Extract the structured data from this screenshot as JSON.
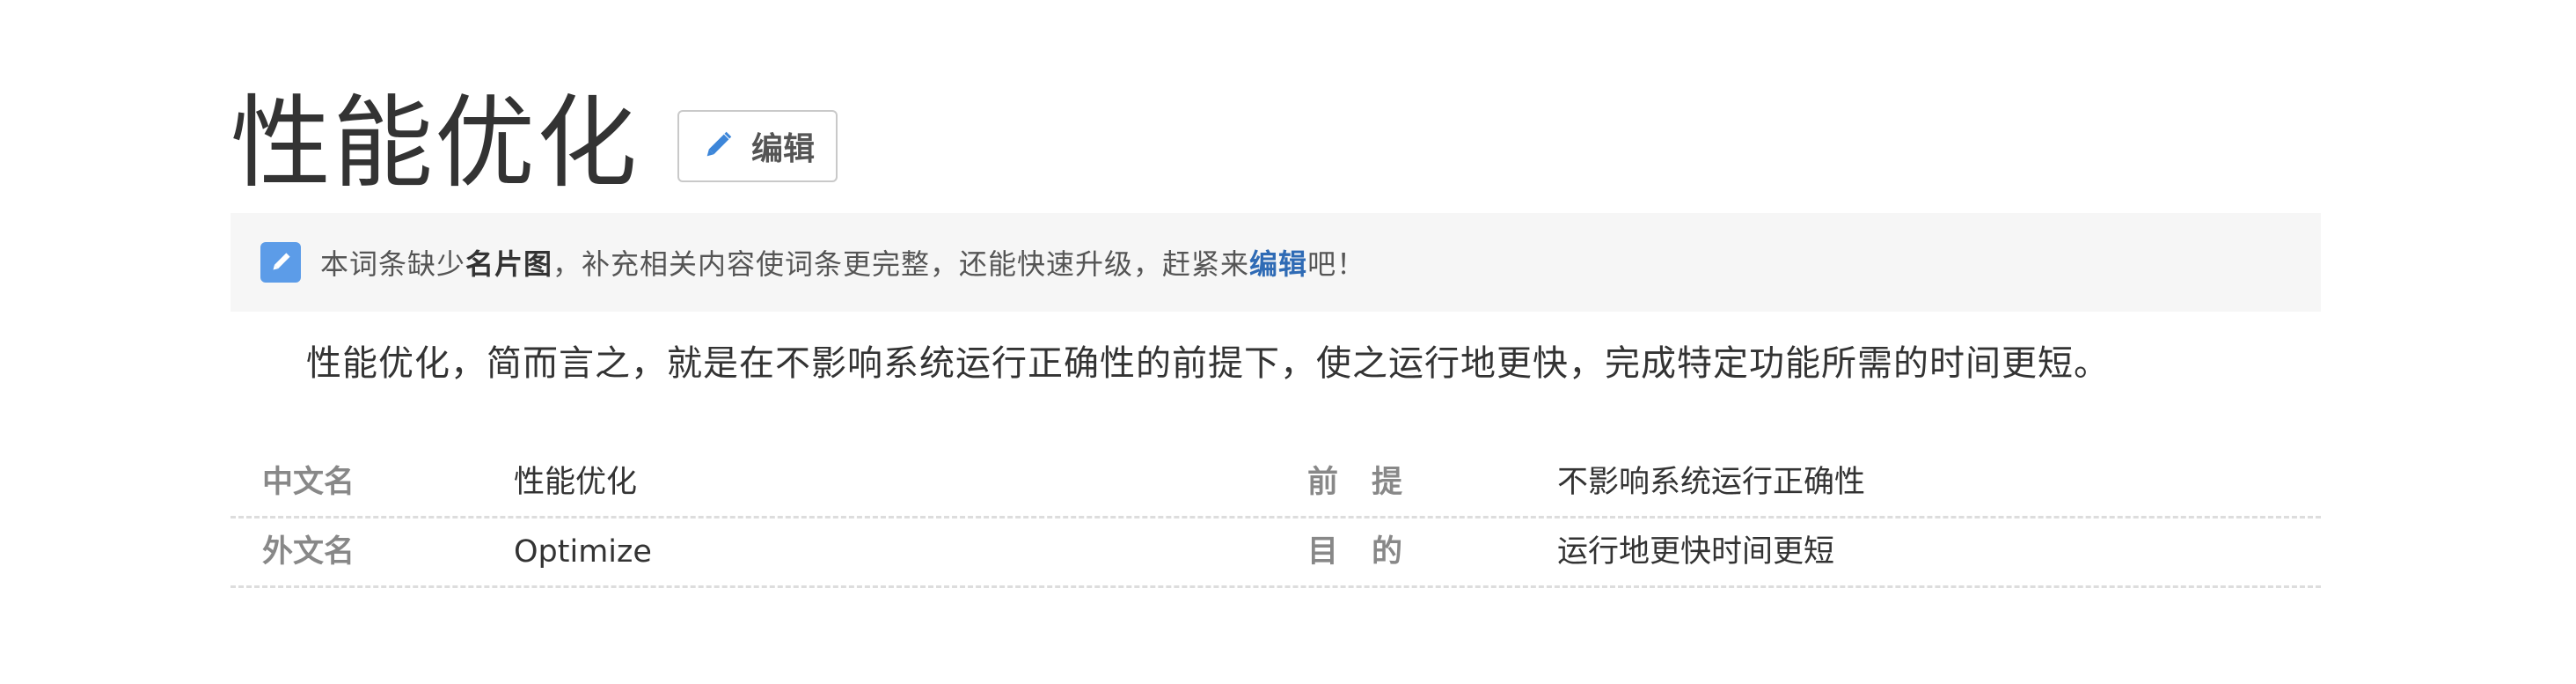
{
  "title": "性能优化",
  "edit_button": {
    "label": "编辑",
    "icon": "pencil-icon"
  },
  "notice": {
    "icon": "edit-note-icon",
    "text_before": "本词条缺少",
    "bold": "名片图",
    "text_middle": "，补充相关内容使词条更完整，还能快速升级，赶紧来",
    "link": "编辑",
    "text_after": "吧！"
  },
  "summary": "性能优化，简而言之，就是在不影响系统运行正确性的前提下，使之运行地更快，完成特定功能所需的时间更短。",
  "basic_info": [
    {
      "key1": "中文名",
      "value1": "性能优化",
      "key2": "前提",
      "value2": "不影响系统运行正确性"
    },
    {
      "key1": "外文名",
      "value1": "Optimize",
      "key2": "目的",
      "value2": "运行地更快时间更短"
    }
  ],
  "colors": {
    "link": "#2f6bb5",
    "notice_bg": "#f6f6f6",
    "icon_blue": "#5c9ce8"
  }
}
